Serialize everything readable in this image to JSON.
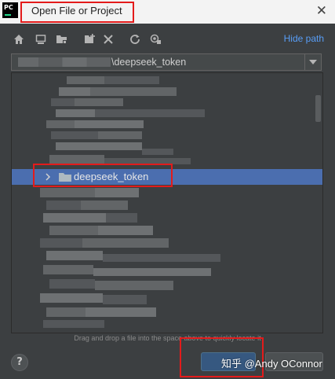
{
  "window": {
    "title": "Open File or Project",
    "close_glyph": "✕",
    "app_icon_text": "PC"
  },
  "toolbar": {
    "icons": [
      "home-icon",
      "desktop-icon",
      "project-folder-icon",
      "new-folder-icon",
      "delete-icon",
      "refresh-icon",
      "show-hidden-icon"
    ],
    "hide_path_label": "Hide path"
  },
  "path_field": {
    "value": "\\deepseek_token"
  },
  "tree": {
    "selected_item": {
      "label": "deepseek_token",
      "icon": "folder-icon"
    }
  },
  "hint_text": "Drag and drop a file into the space above to quickly locate it",
  "buttons": {
    "help_label": "?",
    "ok_label": "",
    "cancel_label": ""
  },
  "watermark": "知乎 @Andy OConnor",
  "colors": {
    "accent": "#4b6eaf",
    "link": "#589df6",
    "highlight": "#e31b1b",
    "background": "#3c3f41"
  }
}
